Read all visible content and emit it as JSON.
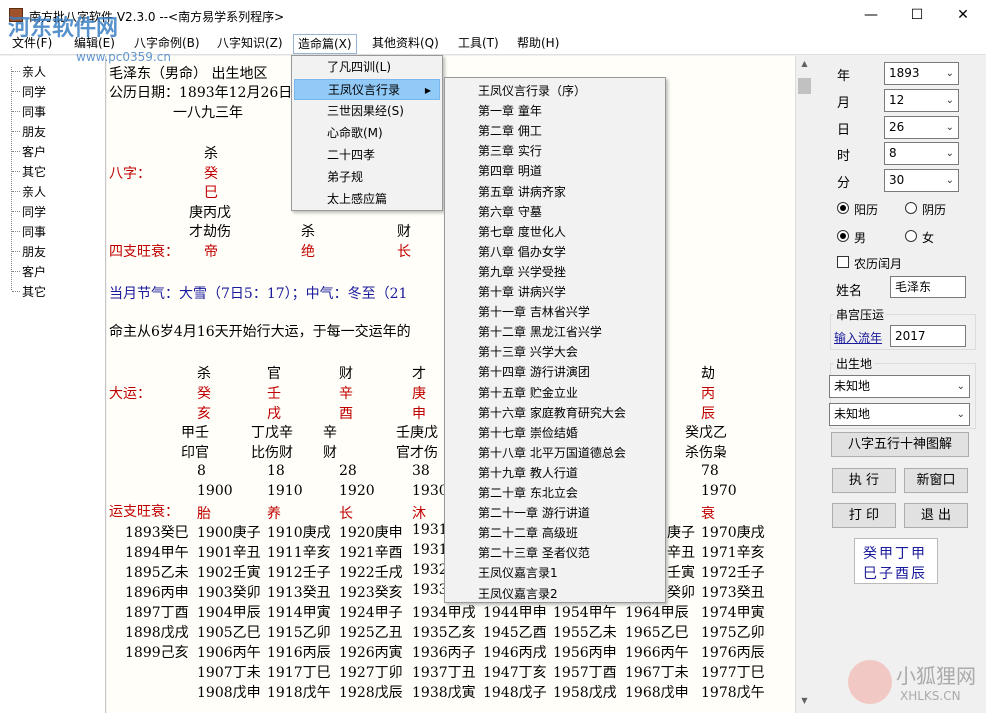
{
  "window": {
    "title": "南方批八字软件 V2.3.0 --<南方易学系列程序>"
  },
  "menubar": [
    "文件(F)",
    "编辑(E)",
    "八字命例(B)",
    "八字知识(Z)",
    "造命篇(X)",
    "其他资料(Q)",
    "工具(T)",
    "帮助(H)"
  ],
  "tree": [
    "亲人",
    "同学",
    "同事",
    "朋友",
    "客户",
    "其它",
    "亲人",
    "同学",
    "同事",
    "朋友",
    "客户",
    "其它"
  ],
  "doc": {
    "line1": "毛泽东（男命） 出生地区",
    "line2": "公历日期：1893年12月26日",
    "line3": "一八九三年",
    "bazi_label": "八字：",
    "bazi_top": "杀",
    "bazi_g1": "癸",
    "bazi_g2": "巳",
    "bazi_hidden": "庚丙戊",
    "bazi_hidden2": "才劫伤",
    "hidden_c2": "杀",
    "hidden_c3": "财",
    "wang_label": "四支旺衰：",
    "wang_1": "帝",
    "wang_2": "绝",
    "wang_3": "长",
    "jieqi": "当月节气：大雪（7日5：17）；中气：冬至（21",
    "qiyun": "命主从6岁4月16天开始行大运，于每一交运年的",
    "dayun_label": "大运：",
    "dayun_top": [
      "杀",
      "官",
      "财",
      "才",
      "劫"
    ],
    "dayun_gan": [
      "癸",
      "壬",
      "辛",
      "庚",
      "丙"
    ],
    "dayun_zhi": [
      "亥",
      "戌",
      "酉",
      "申",
      "辰"
    ],
    "dayun_hid": [
      "甲壬",
      "丁戊辛",
      "辛",
      "壬庚戊",
      "癸戊乙"
    ],
    "dayun_hid2": [
      "印官",
      "比伤财",
      "财",
      "官才伤",
      "杀伤枭"
    ],
    "dayun_age": [
      "8",
      "18",
      "28",
      "38",
      "78"
    ],
    "dayun_year": [
      "1900",
      "1910",
      "1920",
      "1930",
      "1970"
    ],
    "yunzhi_label": "运支旺衰：",
    "yunzhi": [
      "胎",
      "养",
      "长",
      "沐",
      "衰"
    ],
    "col0": [
      "1893癸巳",
      "1894甲午",
      "1895乙未",
      "1896丙申",
      "1897丁酉",
      "1898戊戌",
      "1899己亥"
    ],
    "col1": [
      "1900庚子",
      "1901辛丑",
      "1902壬寅",
      "1903癸卯",
      "1904甲辰",
      "1905乙巳",
      "1906丙午",
      "1907丁未",
      "1908戊申"
    ],
    "col2": [
      "1910庚戌",
      "1911辛亥",
      "1912壬子",
      "1913癸丑",
      "1914甲寅",
      "1915乙卯",
      "1916丙辰",
      "1917丁巳",
      "1918戊午"
    ],
    "col3": [
      "1920庚申",
      "1921辛酉",
      "1922壬戌",
      "1923癸亥",
      "1924甲子",
      "1925乙丑",
      "1926丙寅",
      "1927丁卯",
      "1928戊辰"
    ],
    "col4": [
      "1931",
      "1931",
      "1932",
      "1933",
      "1934甲戌",
      "1935乙亥",
      "1936丙子",
      "1937丁丑",
      "1938戊寅"
    ],
    "col5": [
      "1944甲申",
      "1945乙酉",
      "1946丙戌",
      "1947丁亥",
      "1948戊子"
    ],
    "col6": [
      "1954甲午",
      "1955乙未",
      "1956丙申",
      "1957丁酉",
      "1958戊戌"
    ],
    "col7": [
      "庚子",
      "辛丑",
      "壬寅",
      "癸卯",
      "1964甲辰",
      "1965乙巳",
      "1966丙午",
      "1967丁未",
      "1968戊申"
    ],
    "col8": [
      "1970庚戌",
      "1971辛亥",
      "1972壬子",
      "1973癸丑",
      "1974甲寅",
      "1975乙卯",
      "1976丙辰",
      "1977丁巳",
      "1978戊午"
    ]
  },
  "menu_zaoming": [
    "了凡四训(L)",
    "王凤仪言行录",
    "三世因果经(S)",
    "心命歌(M)",
    "二十四孝",
    "弟子规",
    "太上感应篇"
  ],
  "menu_wang": [
    "王凤仪言行录（序）",
    "第一章 童年",
    "第二章 佣工",
    "第三章 实行",
    "第四章 明道",
    "第五章 讲病齐家",
    "第六章 守墓",
    "第七章 度世化人",
    "第八章 倡办女学",
    "第九章 兴学受挫",
    "第十章 讲病兴学",
    "第十一章 吉林省兴学",
    "第十二章 黑龙江省兴学",
    "第十三章 兴学大会",
    "第十四章 游行讲演团",
    "第十五章 贮金立业",
    "第十六章 家庭教育研究大会",
    "第十七章 崇俭结婚",
    "第十八章 北平万国道德总会",
    "第十九章 教人行道",
    "第二十章 东北立会",
    "第二十一章 游行讲道",
    "第二十二章 高级班",
    "第二十三章 圣者仪范",
    "王凤仪嘉言录1",
    "王凤仪嘉言录2"
  ],
  "right": {
    "year_label": "年",
    "year": "1893",
    "month_label": "月",
    "month": "12",
    "day_label": "日",
    "day": "26",
    "hour_label": "时",
    "hour": "8",
    "min_label": "分",
    "min": "30",
    "solar": "阳历",
    "lunar": "阴历",
    "male": "男",
    "female": "女",
    "leap": "农历闰月",
    "name_label": "姓名",
    "name": "毛泽东",
    "group1": "串宫压运",
    "liunian_label": "输入流年",
    "liunian": "2017",
    "group2": "出生地",
    "place1": "未知地",
    "place2": "未知地",
    "btn_chart": "八字五行十神图解",
    "btn_run": "执 行",
    "btn_new": "新窗口",
    "btn_print": "打 印",
    "btn_exit": "退 出",
    "bazi_gan": "癸甲丁甲",
    "bazi_zhi": "巳子酉辰"
  },
  "watermarks": {
    "w1": "河东软件网",
    "w2": "www.pc0359.cn",
    "w3": "小狐狸网",
    "w4": "XHLKS.CN"
  }
}
